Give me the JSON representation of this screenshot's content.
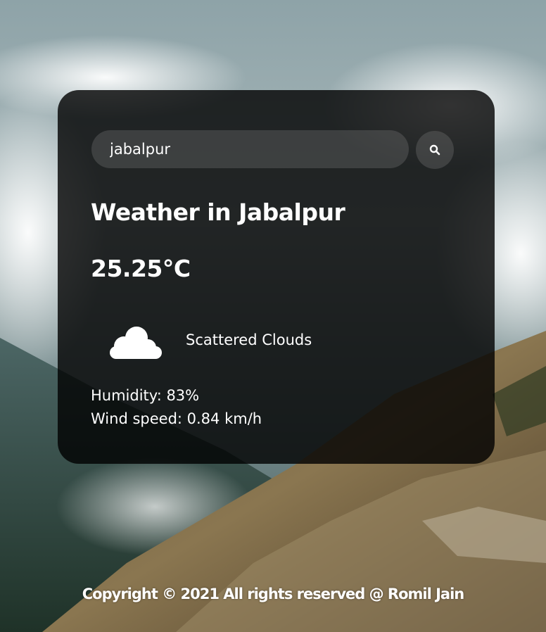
{
  "search": {
    "value": "jabalpur"
  },
  "weather": {
    "city_heading": "Weather in Jabalpur",
    "temperature": "25.25°C",
    "icon": "cloud-icon",
    "description": "Scattered Clouds",
    "humidity": "Humidity: 83%",
    "wind": "Wind speed: 0.84 km/h"
  },
  "footer": {
    "copyright": "Copyright © 2021 All rights reserved @ Romil Jain"
  },
  "colors": {
    "card_background": "#1c1c1c",
    "text": "#ffffff",
    "search_field": "#4a4a4a"
  }
}
